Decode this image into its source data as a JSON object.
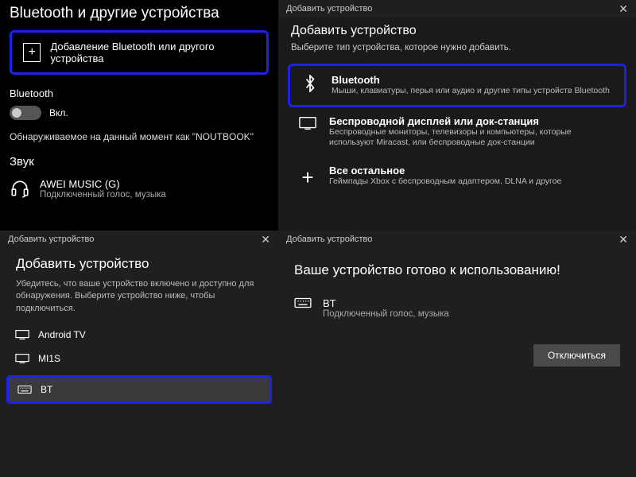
{
  "panel1": {
    "title": "Bluetooth и другие устройства",
    "add_label": "Добавление Bluetooth или другого устройства",
    "bt_label": "Bluetooth",
    "toggle_label": "Вкл.",
    "discoverable": "Обнаруживаемое на данный момент как \"NOUTBOOK\"",
    "sound_label": "Звук",
    "device_name": "AWEI MUSIC (G)",
    "device_status": "Подключенный голос, музыка"
  },
  "panel2": {
    "titlebar": "Добавить устройство",
    "heading": "Добавить устройство",
    "sub": "Выберите тип устройства, которое нужно добавить.",
    "opts": [
      {
        "title": "Bluetooth",
        "desc": "Мыши, клавиатуры, перья или аудио и другие типы устройств Bluetooth"
      },
      {
        "title": "Беспроводной дисплей или док-станция",
        "desc": "Беспроводные мониторы, телевизоры и компьютеры, которые используют Miracast, или беспроводные док-станции"
      },
      {
        "title": "Все остальное",
        "desc": "Геймпады Xbox с беспроводным адаптером, DLNA и другое"
      }
    ]
  },
  "panel3": {
    "titlebar": "Добавить устройство",
    "heading": "Добавить устройство",
    "sub": "Убедитесь, что ваше устройство включено и доступно для обнаружения. Выберите устройство ниже, чтобы подключиться.",
    "devices": [
      "Android TV",
      "MI1S",
      "BT"
    ]
  },
  "panel4": {
    "titlebar": "Добавить устройство",
    "heading": "Ваше устройство готово к использованию!",
    "dev_name": "BT",
    "dev_status": "Подключенный голос, музыка",
    "disconnect": "Отключиться"
  }
}
